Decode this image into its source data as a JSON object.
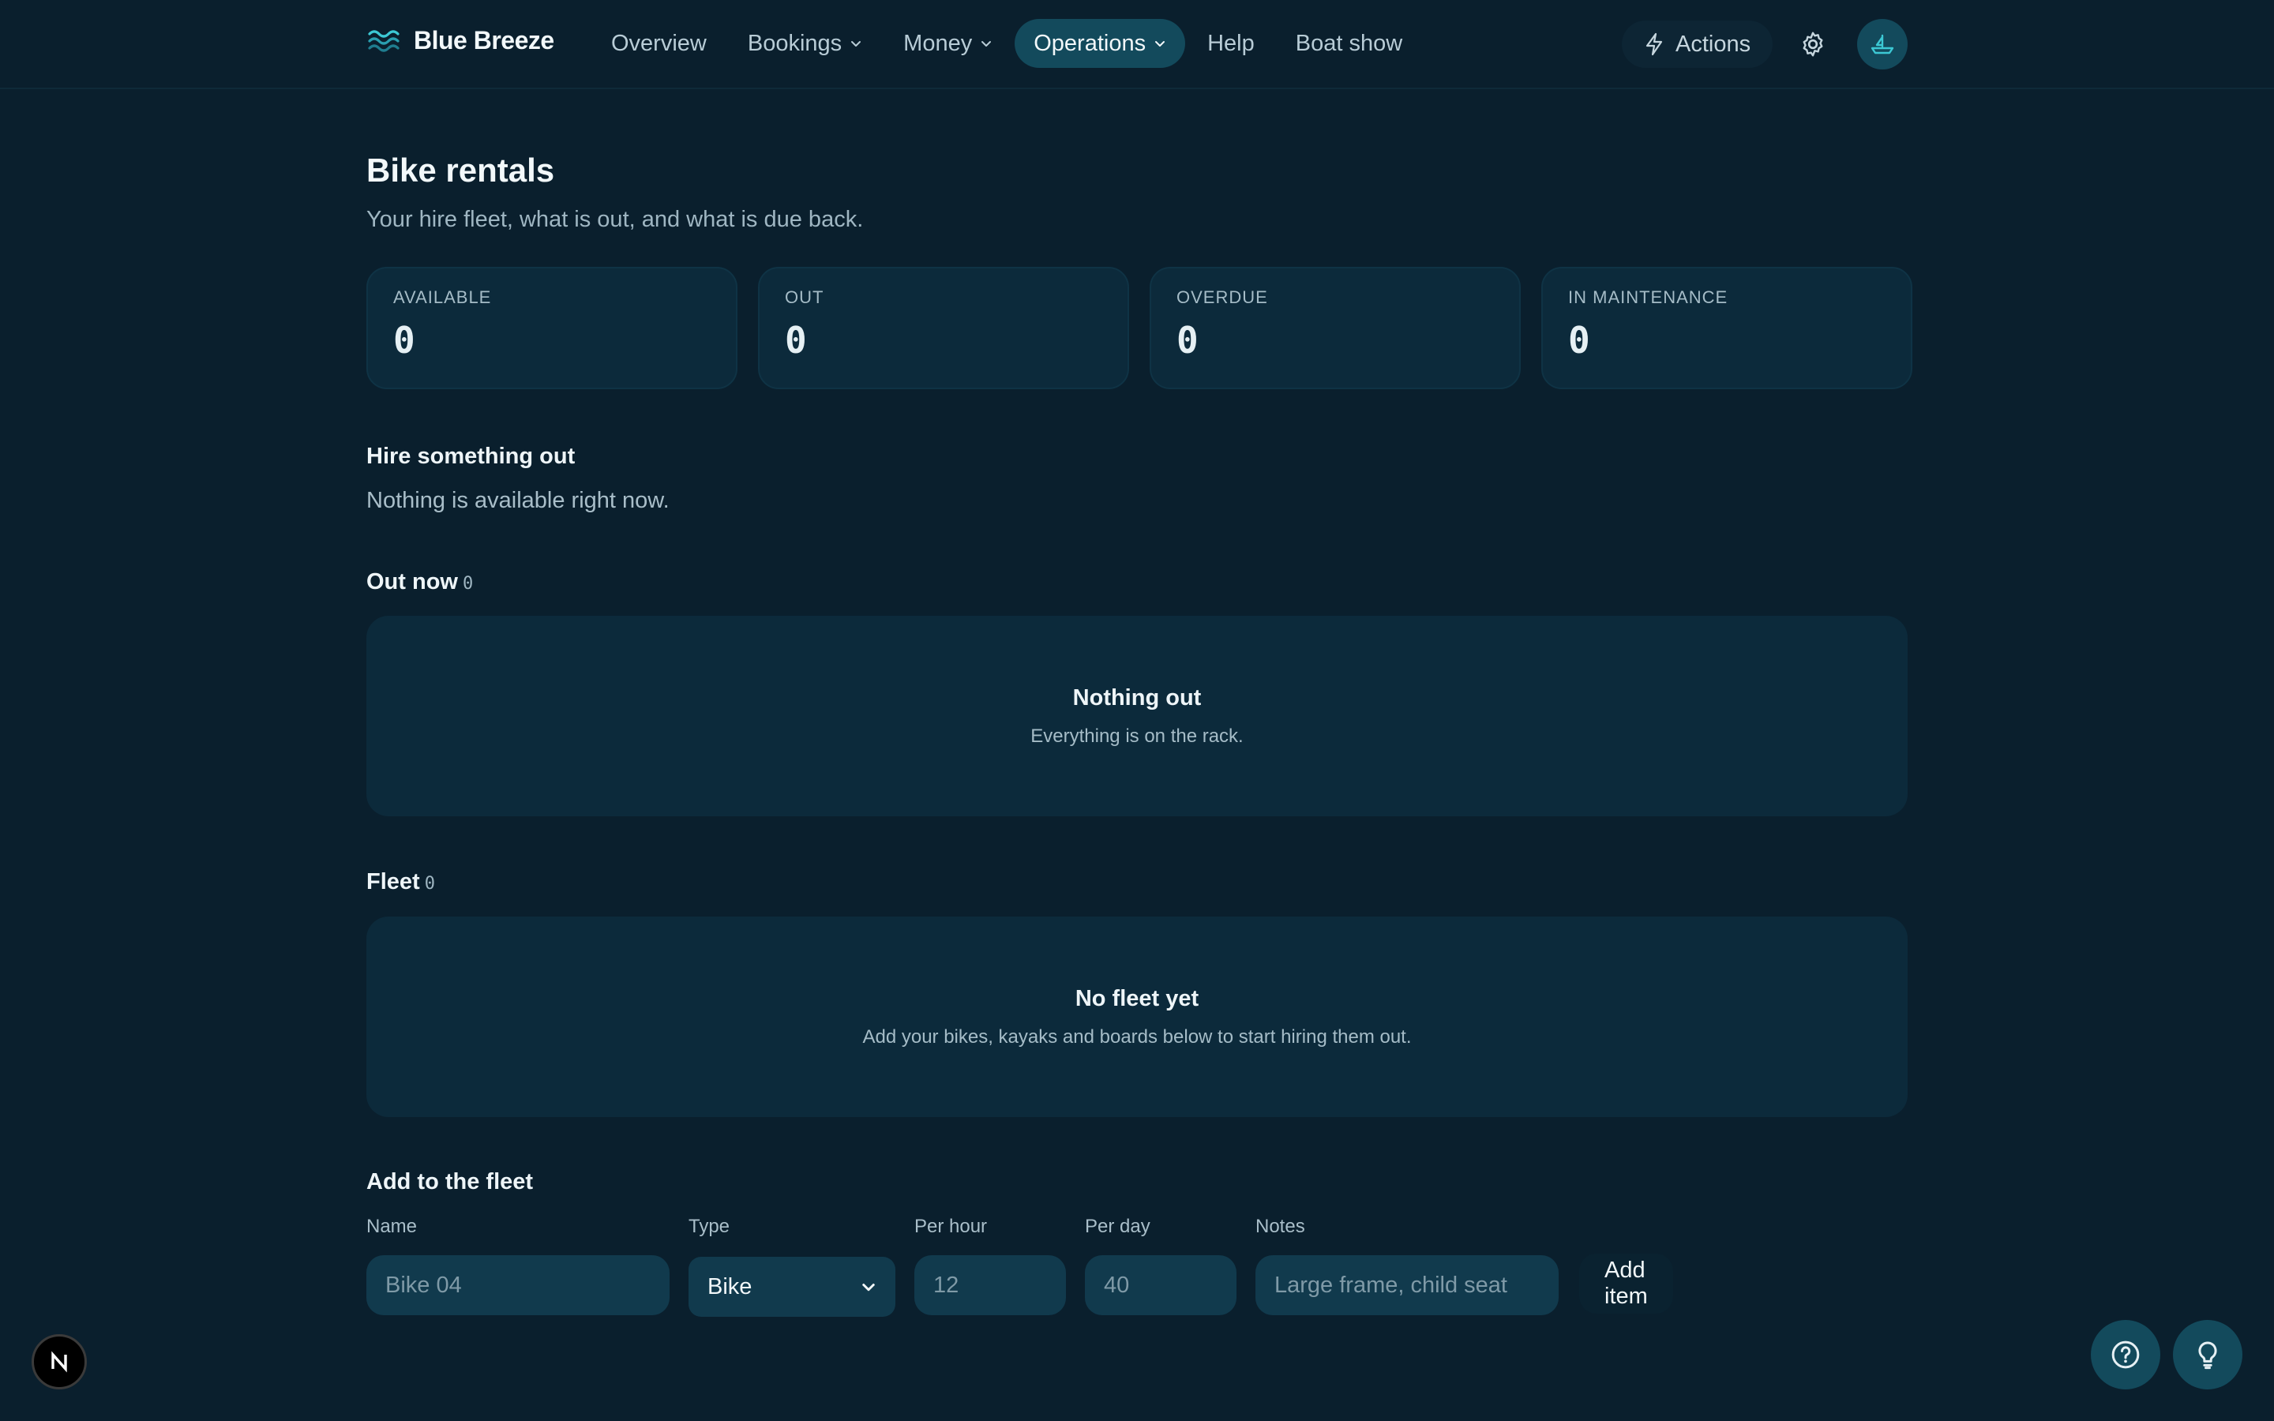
{
  "brand": {
    "name": "Blue Breeze"
  },
  "nav": {
    "items": [
      {
        "label": "Overview"
      },
      {
        "label": "Bookings"
      },
      {
        "label": "Money"
      },
      {
        "label": "Operations"
      },
      {
        "label": "Help"
      },
      {
        "label": "Boat show"
      }
    ],
    "active": "Operations",
    "actions_label": "Actions"
  },
  "page": {
    "title": "Bike rentals",
    "subtitle": "Your hire fleet, what is out, and what is due back."
  },
  "stats": [
    {
      "label": "AVAILABLE",
      "value": "0"
    },
    {
      "label": "OUT",
      "value": "0"
    },
    {
      "label": "OVERDUE",
      "value": "0"
    },
    {
      "label": "IN MAINTENANCE",
      "value": "0"
    }
  ],
  "hire": {
    "heading": "Hire something out",
    "message": "Nothing is available right now."
  },
  "out_now": {
    "heading": "Out now",
    "count": "0",
    "empty_title": "Nothing out",
    "empty_sub": "Everything is on the rack."
  },
  "fleet": {
    "heading": "Fleet",
    "count": "0",
    "empty_title": "No fleet yet",
    "empty_sub": "Add your bikes, kayaks and boards below to start hiring them out."
  },
  "add_form": {
    "heading": "Add to the fleet",
    "name_label": "Name",
    "name_placeholder": "Bike 04",
    "type_label": "Type",
    "type_value": "Bike",
    "per_hour_label": "Per hour",
    "per_hour_placeholder": "12",
    "per_day_label": "Per day",
    "per_day_placeholder": "40",
    "notes_label": "Notes",
    "notes_placeholder": "Large frame, child seat",
    "submit_label": "Add item"
  },
  "colors": {
    "background": "#0a1f2d",
    "card": "#0c2a3b",
    "accent": "#134a5c",
    "accent_icon": "#3cc8d4"
  },
  "icons": [
    "waves-logo-icon",
    "chevron-down-icon",
    "lightning-icon",
    "gear-icon",
    "boat-icon",
    "help-circle-icon",
    "lightbulb-icon",
    "n-logo-icon"
  ]
}
